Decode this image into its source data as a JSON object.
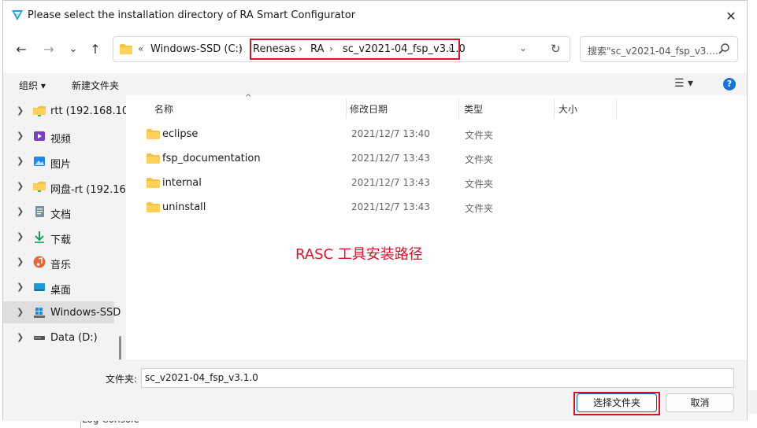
{
  "background": {
    "log_label": "Log Console"
  },
  "dialog": {
    "title": "Please select the installation directory of RA Smart Configurator",
    "close_glyph": "✕",
    "nav": {
      "back": "←",
      "forward": "→",
      "recent": "⌄",
      "up": "↑"
    },
    "address": {
      "prefix": "«",
      "items": [
        "Windows-SSD (C:)",
        "Renesas",
        "RA",
        "sc_v2021-04_fsp_v3.1.0"
      ],
      "separator": "›",
      "dropdown_glyph": "⌄",
      "refresh_glyph": "↻"
    },
    "search": {
      "placeholder": "搜索\"sc_v2021-04_fsp_v3....",
      "icon": "search-icon"
    },
    "toolbar": {
      "organize": "组织 ▾",
      "new_folder": "新建文件夹",
      "view_glyph": "☰ ▾",
      "help_glyph": "?"
    },
    "sidebar": {
      "items": [
        {
          "label": "rtt (192.168.10",
          "icon": "network-folder-icon"
        },
        {
          "label": "视频",
          "icon": "video-icon"
        },
        {
          "label": "图片",
          "icon": "picture-icon"
        },
        {
          "label": "网盘-rt (192.16",
          "icon": "network-folder-icon"
        },
        {
          "label": "文档",
          "icon": "document-icon"
        },
        {
          "label": "下载",
          "icon": "download-icon"
        },
        {
          "label": "音乐",
          "icon": "music-icon"
        },
        {
          "label": "桌面",
          "icon": "desktop-icon"
        },
        {
          "label": "Windows-SSD",
          "icon": "drive-c-icon",
          "selected": true
        },
        {
          "label": "Data (D:)",
          "icon": "drive-d-icon"
        }
      ]
    },
    "columns": {
      "name": "名称",
      "date": "修改日期",
      "type": "类型",
      "size": "大小",
      "sort_glyph": "^"
    },
    "files": [
      {
        "name": "eclipse",
        "date": "2021/12/7 13:40",
        "type": "文件夹"
      },
      {
        "name": "fsp_documentation",
        "date": "2021/12/7 13:43",
        "type": "文件夹"
      },
      {
        "name": "internal",
        "date": "2021/12/7 13:43",
        "type": "文件夹"
      },
      {
        "name": "uninstall",
        "date": "2021/12/7 13:43",
        "type": "文件夹"
      }
    ],
    "annotation": "RASC 工具安装路径",
    "folder_field": {
      "label": "文件夹:",
      "value": "sc_v2021-04_fsp_v3.1.0"
    },
    "buttons": {
      "select": "选择文件夹",
      "cancel": "取消"
    },
    "colors": {
      "highlight_red": "#e0102a",
      "folder_yellow": "#f5c242",
      "accent_blue": "#1a73d9"
    }
  }
}
